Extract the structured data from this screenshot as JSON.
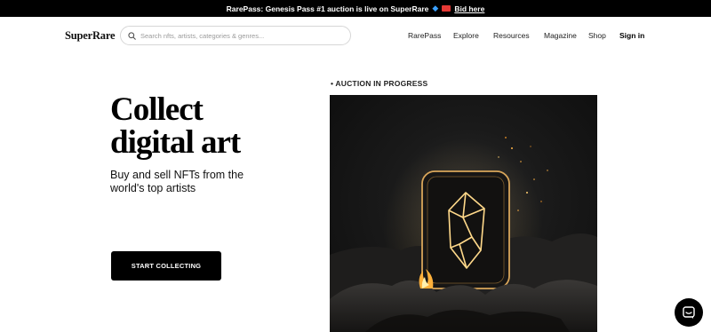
{
  "announcement": {
    "text": "RarePass: Genesis Pass #1 auction is live on SuperRare",
    "link_label": "Bid here"
  },
  "header": {
    "logo": "SuperRare",
    "search_placeholder": "Search nfts, artists, categories & genres...",
    "nav": [
      "RarePass",
      "Explore",
      "Resources",
      "Magazine",
      "Shop"
    ],
    "signin_label": "Sign in"
  },
  "hero": {
    "title_line1": "Collect",
    "title_line2": "digital art",
    "subtitle": "Buy and sell NFTs from the world's top artists",
    "cta_label": "START COLLECTING"
  },
  "auction": {
    "label": "• AUCTION IN PROGRESS"
  },
  "icons": {
    "search": "search-icon",
    "chat": "chat-icon",
    "gem": "gem-icon",
    "ticket": "ticket-icon"
  },
  "colors": {
    "announcement_bg": "#000000",
    "cta_bg": "#000000",
    "glow": "#ffb347"
  }
}
